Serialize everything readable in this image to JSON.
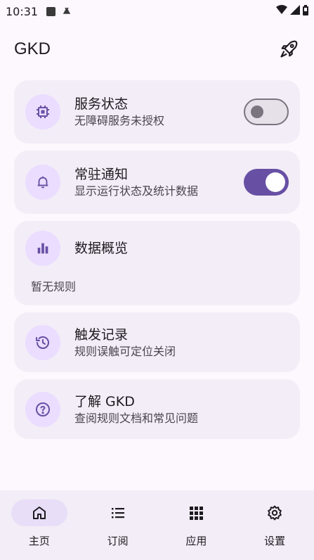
{
  "status_bar": {
    "time": "10:31",
    "a_badge": "A"
  },
  "app": {
    "title": "GKD"
  },
  "cards": {
    "service": {
      "title": "服务状态",
      "subtitle": "无障碍服务未授权",
      "toggle": "off"
    },
    "notification": {
      "title": "常驻通知",
      "subtitle": "显示运行状态及统计数据",
      "toggle": "on"
    },
    "overview": {
      "title": "数据概览",
      "empty": "暂无规则"
    },
    "records": {
      "title": "触发记录",
      "subtitle": "规则误触可定位关闭"
    },
    "about": {
      "title": "了解 GKD",
      "subtitle": "查阅规则文档和常见问题"
    }
  },
  "nav": {
    "home": "主页",
    "subscription": "订阅",
    "apps": "应用",
    "settings": "设置"
  },
  "colors": {
    "accent": "#6750a4",
    "card_bg": "#f3edf7",
    "icon_bg": "#eaddff",
    "page_bg": "#fdf7fe"
  }
}
